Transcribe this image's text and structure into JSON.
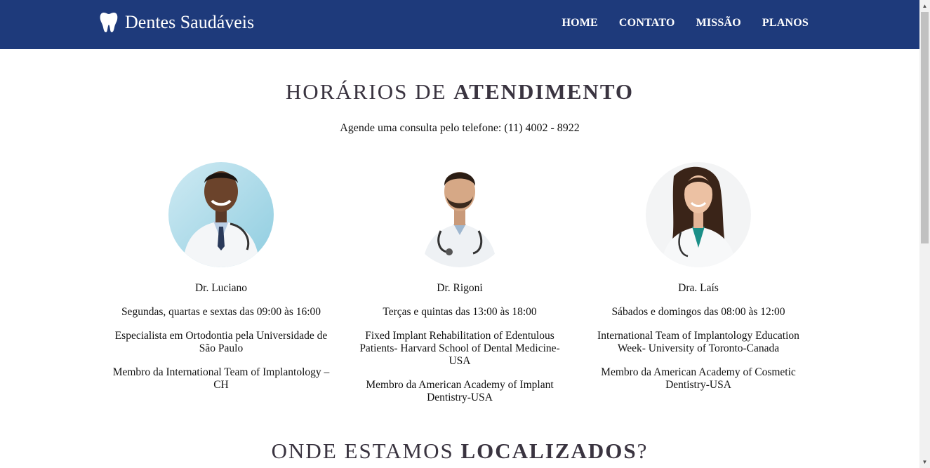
{
  "header": {
    "brand": "Dentes Saudáveis",
    "nav": [
      "HOME",
      "CONTATO",
      "MISSÃO",
      "PLANOS"
    ]
  },
  "hours_section": {
    "title_light": "HORÁRIOS DE ",
    "title_bold": "ATENDIMENTO",
    "subtitle": "Agende uma consulta pelo telefone: (11) 4002 - 8922"
  },
  "doctors": [
    {
      "name": "Dr. Luciano",
      "schedule": "Segundas, quartas e sextas das 09:00 às 16:00",
      "credential_1": "Especialista em Ortodontia pela Universidade de São Paulo",
      "credential_2": "Membro da International Team of Implantology – CH"
    },
    {
      "name": "Dr. Rigoni",
      "schedule": "Terças e quintas das 13:00 às 18:00",
      "credential_1": "Fixed Implant Rehabilitation of Edentulous Patients- Harvard School of Dental Medicine-USA",
      "credential_2": "Membro da American Academy of Implant Dentistry-USA"
    },
    {
      "name": "Dra. Laís",
      "schedule": "Sábados e domingos das 08:00 às 12:00",
      "credential_1": "International Team of Implantology Education Week- University of Toronto-Canada",
      "credential_2": "Membro da American Academy of Cosmetic Dentistry-USA"
    }
  ],
  "location_section": {
    "title_light": "ONDE ESTAMOS ",
    "title_bold": "LOCALIZADOS",
    "title_end": "?"
  },
  "colors": {
    "header_bg": "#1e3a7b",
    "heading_text": "#3a3440"
  },
  "icons": {
    "brand": "tooth-icon"
  }
}
